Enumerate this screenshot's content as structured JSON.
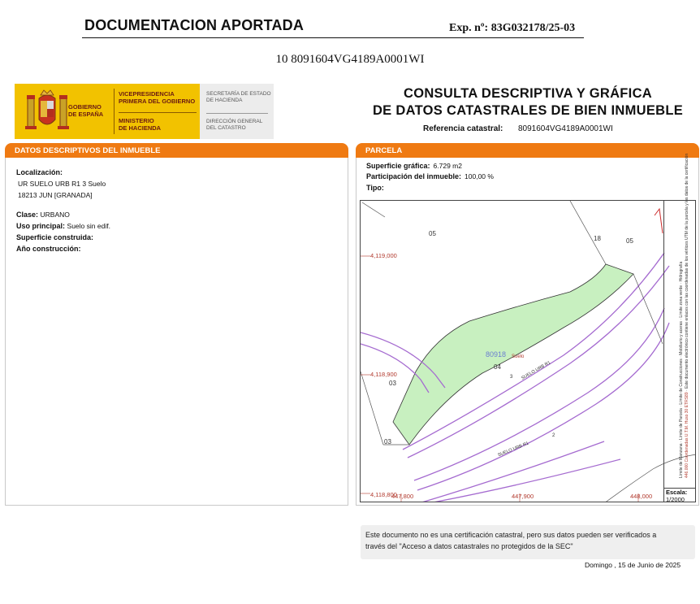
{
  "header": {
    "title": "DOCUMENTACION APORTADA",
    "expediente": "Exp. nº: 83G032178/25-03",
    "reference_line": "10 8091604VG4189A0001WI"
  },
  "logo": {
    "gobierno": "GOBIERNO\nDE ESPAÑA",
    "vicepresidencia": "VICEPRESIDENCIA\nPRIMERA DEL GOBIERNO",
    "ministerio": "MINISTERIO\nDE HACIENDA",
    "secretaria": "SECRETARÍA DE ESTADO\nDE HACIENDA",
    "direccion": "DIRECCIÓN GENERAL\nDEL CATASTRO"
  },
  "consulta": {
    "title_line1": "CONSULTA DESCRIPTIVA Y GRÁFICA",
    "title_line2": "DE DATOS CATASTRALES DE BIEN INMUEBLE",
    "refcat_label": "Referencia catastral:",
    "refcat_value": "8091604VG4189A0001WI"
  },
  "left_panel": {
    "heading": "DATOS DESCRIPTIVOS DEL INMUEBLE",
    "localizacion_label": "Localización:",
    "localizacion_line1": "UR SUELO URB R1 3 Suelo",
    "localizacion_line2": "18213 JUN [GRANADA]",
    "clase_label": "Clase:",
    "clase_value": "URBANO",
    "uso_label": "Uso principal:",
    "uso_value": "Suelo sin edif.",
    "superficie_label": "Superficie construida:",
    "anio_label": "Año construcción:"
  },
  "right_panel": {
    "heading": "PARCELA",
    "superficie_label": "Superficie gráfica:",
    "superficie_value": "6.729 m2",
    "participacion_label": "Participación del inmueble:",
    "participacion_value": "100,00 %",
    "tipo_label": "Tipo:"
  },
  "map": {
    "coords": {
      "y1": "4,119,000",
      "y2": "4,118,900",
      "y3": "4,118,800",
      "x1": "447,800",
      "x2": "447,900",
      "x3": "448,000"
    },
    "parcels": {
      "p05a": "05",
      "p05b": "05",
      "p18": "18",
      "p03a": "03",
      "p03b": "03",
      "p04": "04",
      "p80918": "80918",
      "suelo": "Suelo",
      "street1": "SUELO URB R1",
      "street2": "SUELO URB R1",
      "n3": "3",
      "n2": "2"
    },
    "legend": {
      "line1": "Límite de Manzana",
      "line2": "Límite de Parcela",
      "line3": "Límite de Construcciones",
      "line4": "Mobiliario y aceras",
      "line5": "Límite zona verde",
      "line6": "Hidrografía",
      "note1": "Este documento electrónico contiene enlaces con las coordenadas de los vértices UTM de la parcela y los datos de la certificación",
      "note2": "446.000 Coordenadas U.T.M. Huso 30 ETRS89"
    },
    "scale_label": "Escala:",
    "scale_value": "1/2000"
  },
  "notice": {
    "line1": "Este documento no es una certificación catastral, pero sus datos pueden ser verificados a",
    "line2": "través del \"Acceso a datos catastrales no protegidos de la SEC\""
  },
  "date": "Domingo , 15 de Junio de 2025",
  "colors": {
    "orange": "#ef7a12",
    "gold": "#f2c200",
    "parcel_green": "#c8f0c0",
    "street_purple": "#a56bd0"
  }
}
